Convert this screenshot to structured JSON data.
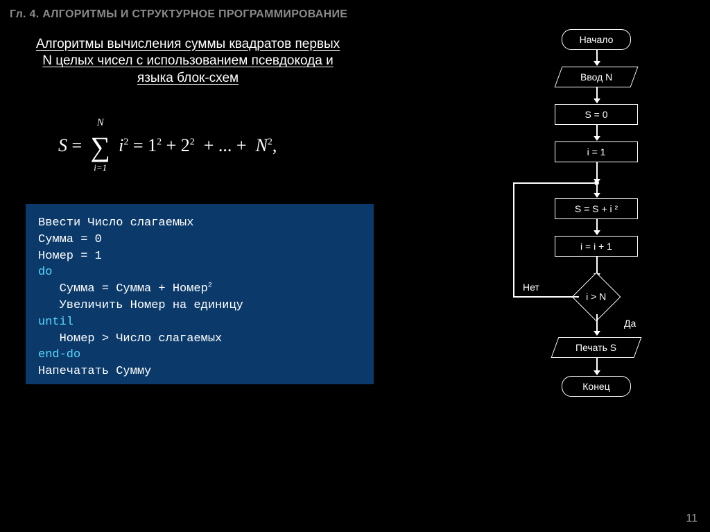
{
  "chapter": "Гл. 4. АЛГОРИТМЫ И СТРУКТУРНОЕ ПРОГРАММИРОВАНИЕ",
  "title_line1": "Алгоритмы вычисления суммы квадратов первых",
  "title_line2": "N целых чисел с использованием псевдокода и",
  "title_line3": "языка блок-схем",
  "formula": {
    "S": "S",
    "eq": "=",
    "sum_upper": "N",
    "sum_lower": "i=1",
    "body": "i",
    "exp": "2",
    "rhs_1": "1",
    "rhs_2": "2",
    "dots": "+ ... +",
    "N": "N",
    "tail": ","
  },
  "code": {
    "l1": "Ввести Число слагаемых",
    "l2": "Сумма = 0",
    "l3": "Номер = 1",
    "l4": "do",
    "l5a": "   Сумма = Сумма + Номер",
    "l5sup": "2",
    "l6": "   Увеличить Номер на единицу",
    "l7": "until",
    "l8": "   Номер > Число слагаемых",
    "l9": "end-do",
    "l10": "Напечатать Сумму"
  },
  "flow": {
    "start": "Начало",
    "input": "Ввод N",
    "s0": "S = 0",
    "i1": "i = 1",
    "ssi": "S = S + i ²",
    "iinc": "i = i + 1",
    "cond": "i > N",
    "no": "Нет",
    "yes": "Да",
    "print": "Печать S",
    "end": "Конец"
  },
  "pagenum": "11"
}
